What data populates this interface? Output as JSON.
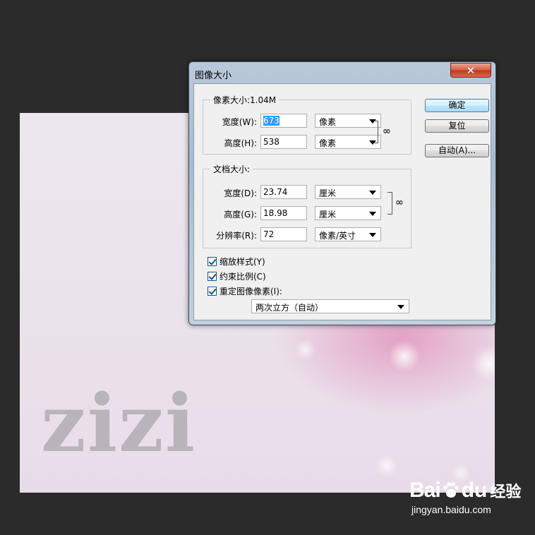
{
  "canvas": {
    "logo_text": "zizi"
  },
  "watermark": {
    "brand_left": "Bai",
    "brand_right": "du",
    "brand_suffix": "经验",
    "url": "jingyan.baidu.com"
  },
  "dialog": {
    "title": "图像大小",
    "close_glyph": "✕",
    "pixel_dimensions": {
      "legend": "像素大小:1.04M",
      "width_label": "宽度(W):",
      "width_value": "673",
      "width_unit": "像素",
      "height_label": "高度(H):",
      "height_value": "538",
      "height_unit": "像素"
    },
    "document_size": {
      "legend": "文档大小:",
      "width_label": "宽度(D):",
      "width_value": "23.74",
      "width_unit": "厘米",
      "height_label": "高度(G):",
      "height_value": "18.98",
      "height_unit": "厘米",
      "resolution_label": "分辨率(R):",
      "resolution_value": "72",
      "resolution_unit": "像素/英寸"
    },
    "options": {
      "scale_styles": "缩放样式(Y)",
      "constrain_proportions": "约束比例(C)",
      "resample_image": "重定图像像素(I):",
      "scale_styles_checked": true,
      "constrain_proportions_checked": true,
      "resample_image_checked": true,
      "resample_method": "两次立方（自动）"
    },
    "buttons": {
      "ok": "确定",
      "reset": "复位",
      "auto": "自动(A)..."
    }
  }
}
